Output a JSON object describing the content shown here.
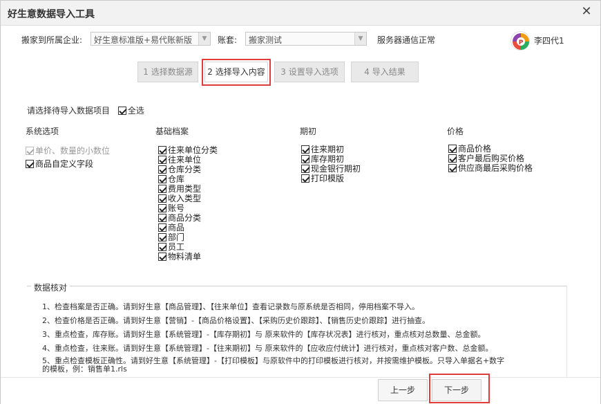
{
  "window": {
    "title": "好生意数据导入工具"
  },
  "header": {
    "company_label": "搬家到所属企业:",
    "company_value": "好生意标准版+易代账新版",
    "account_label": "账套:",
    "account_value": "搬家测试",
    "status": "服务器通信正常",
    "user": "李四代1"
  },
  "steps": [
    {
      "label": "1 选择数据源"
    },
    {
      "label": "2 选择导入内容"
    },
    {
      "label": "3 设置导入选项"
    },
    {
      "label": "4 导入结果"
    }
  ],
  "select": {
    "prompt": "请选择待导入数据项目",
    "all_label": "全选"
  },
  "columns": [
    {
      "title": "系统选项",
      "items": [
        "单价、数量的小数位",
        "商品自定义字段"
      ]
    },
    {
      "title": "基础档案",
      "items": [
        "往来单位分类",
        "往来单位",
        "仓库分类",
        "仓库",
        "费用类型",
        "收入类型",
        "账号",
        "商品分类",
        "商品",
        "部门",
        "员工",
        "物料清单"
      ]
    },
    {
      "title": "期初",
      "items": [
        "往来期初",
        "库存期初",
        "现金银行期初",
        "打印模版"
      ]
    },
    {
      "title": "价格",
      "items": [
        "商品价格",
        "客户最后购买价格",
        "供应商最后采购价格"
      ]
    }
  ],
  "verify": {
    "title": "数据核对",
    "lines": [
      "1、检查档案是否正确。请到好生意【商品管理】、【往来单位】查看记录数与原系统是否相同，停用档案不导入。",
      "2、检查价格是否正确。请到好生意【营销】-【商品价格设置】、【采购历史价跟踪】、【销售历史价跟踪】进行抽查。",
      "3、重点检查，库存账。请到好生意【系统管理】-【库存期初】与 原来软件的【库存状况表】进行核对，重点核对总数量、总金额。",
      "4、重点检查，往来账。请到好生意【系统管理】-【往来期初】与 原来软件的【应收应付统计】进行核对，重点核对客户数、总金额。",
      "5、重点检查模板正确性。请到好生意【系统管理】-【打印模板】与原软件中的打印模板进行核对，并按需维护模板。只导入单据名+数字",
      "的模板，例：销售单1.rls"
    ]
  },
  "footer": {
    "prev": "上一步",
    "next": "下一步"
  },
  "colors": {
    "highlight": "#e03c3c"
  }
}
